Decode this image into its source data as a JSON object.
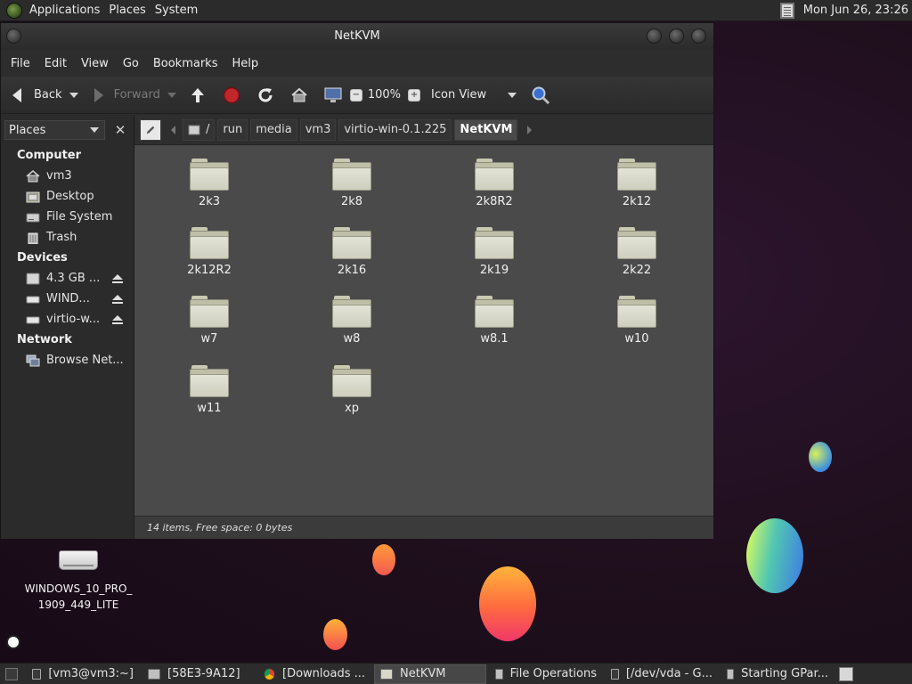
{
  "top_panel": {
    "menus": [
      "Applications",
      "Places",
      "System"
    ],
    "clock": "Mon Jun 26, 23:26"
  },
  "window": {
    "title": "NetKVM",
    "menubar": [
      "File",
      "Edit",
      "View",
      "Go",
      "Bookmarks",
      "Help"
    ],
    "toolbar": {
      "back": "Back",
      "forward": "Forward",
      "zoom": "100%",
      "view_mode": "Icon View"
    },
    "sidebar": {
      "selector": "Places",
      "sections": [
        {
          "title": "Computer",
          "items": [
            "vm3",
            "Desktop",
            "File System",
            "Trash"
          ]
        },
        {
          "title": "Devices",
          "items": [
            "4.3 GB ...",
            "WIND...",
            "virtio-w..."
          ]
        },
        {
          "title": "Network",
          "items": [
            "Browse Net..."
          ]
        }
      ]
    },
    "pathbar": {
      "root": "/",
      "segments": [
        "run",
        "media",
        "vm3",
        "virtio-win-0.1.225",
        "NetKVM"
      ]
    },
    "folders": [
      "2k3",
      "2k8",
      "2k8R2",
      "2k12",
      "2k12R2",
      "2k16",
      "2k19",
      "2k22",
      "w7",
      "w8",
      "w8.1",
      "w10",
      "w11",
      "xp"
    ],
    "status": "14 items, Free space: 0 bytes"
  },
  "desktop": {
    "icon_label_line1": "WINDOWS_10_PRO_",
    "icon_label_line2": "1909_449_LITE"
  },
  "taskbar": {
    "tasks": [
      "[vm3@vm3:~]",
      "[58E3-9A12]",
      "[Downloads ...",
      "NetKVM",
      "File Operations",
      "[/dev/vda - G...",
      "Starting GPar..."
    ],
    "active_task": "NetKVM"
  },
  "colors": {
    "accent_bubble_orange": "#ff7a3c",
    "accent_bubble_blue": "#4a90e2",
    "window_bg": "#2d2d2d",
    "view_bg": "#4a4a4a"
  }
}
